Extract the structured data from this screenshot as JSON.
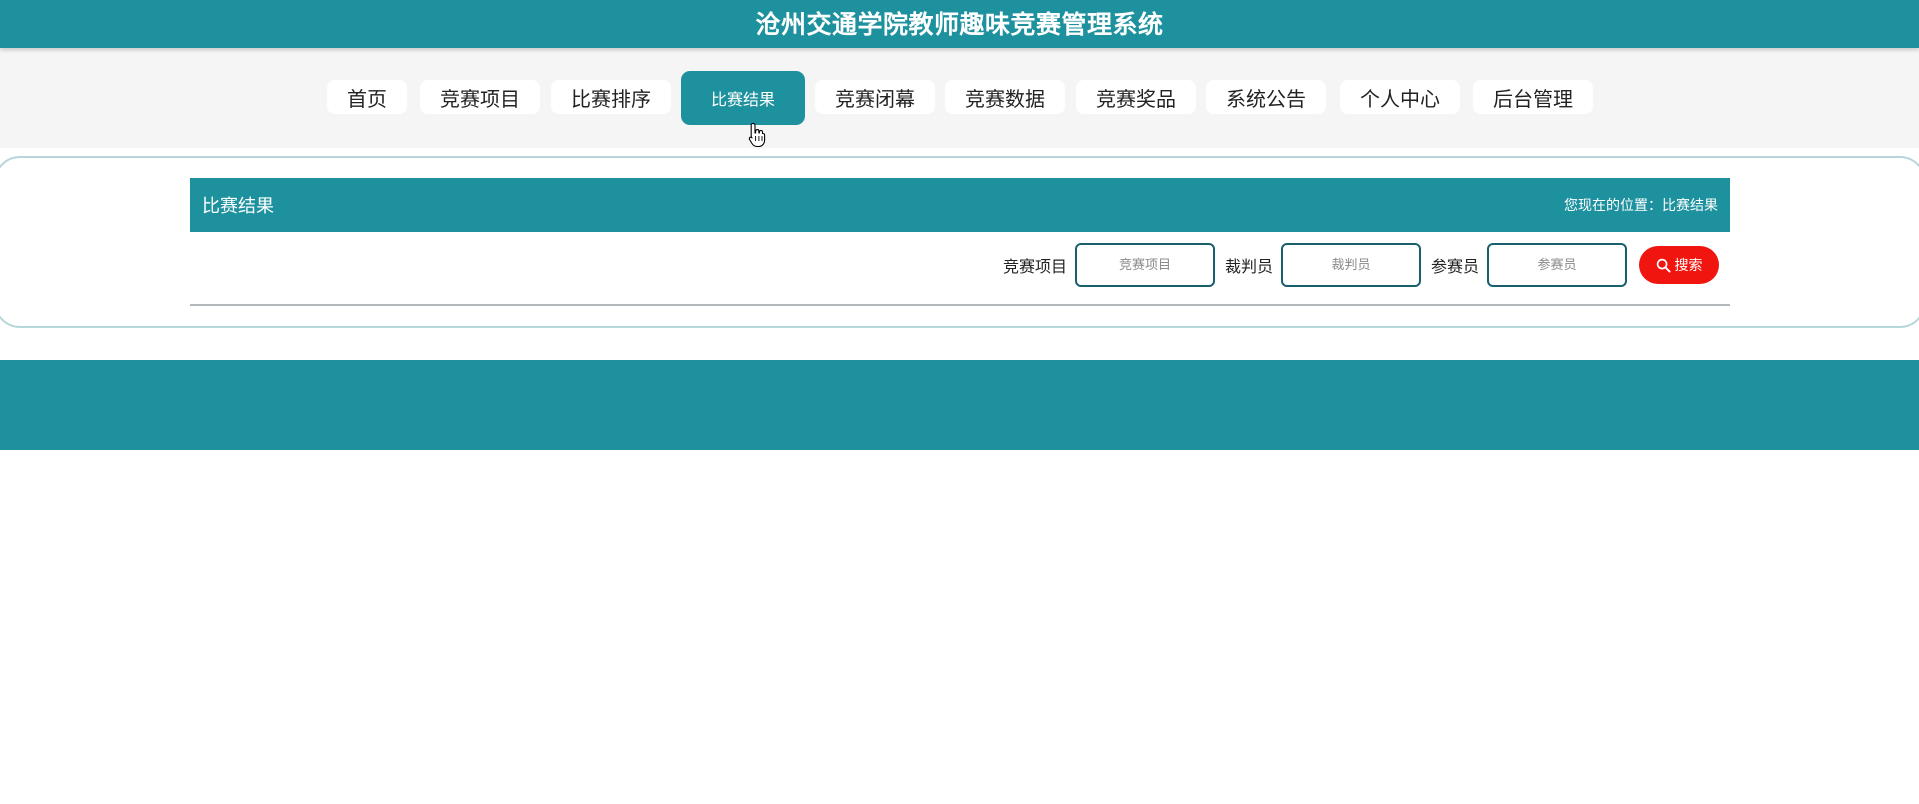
{
  "app": {
    "title": "沧州交通学院教师趣味竞赛管理系统"
  },
  "nav": {
    "items": [
      {
        "label": "首页"
      },
      {
        "label": "竞赛项目"
      },
      {
        "label": "比赛排序"
      },
      {
        "label": "比赛结果",
        "active": true
      },
      {
        "label": "竞赛闭幕"
      },
      {
        "label": "竞赛数据"
      },
      {
        "label": "竞赛奖品"
      },
      {
        "label": "系统公告"
      },
      {
        "label": "个人中心"
      },
      {
        "label": "后台管理"
      }
    ]
  },
  "section": {
    "title": "比赛结果",
    "breadcrumb": "您现在的位置：比赛结果"
  },
  "search": {
    "fields": [
      {
        "label": "竞赛项目",
        "placeholder": "竞赛项目",
        "value": ""
      },
      {
        "label": "裁判员",
        "placeholder": "裁判员",
        "value": ""
      },
      {
        "label": "参赛员",
        "placeholder": "参赛员",
        "value": ""
      }
    ],
    "button_label": "搜索"
  },
  "colors": {
    "primary": "#1e919f",
    "search_button": "#f0160f",
    "input_border": "#1a5f6e"
  },
  "icons": [
    "search-icon",
    "hand-cursor-icon"
  ]
}
